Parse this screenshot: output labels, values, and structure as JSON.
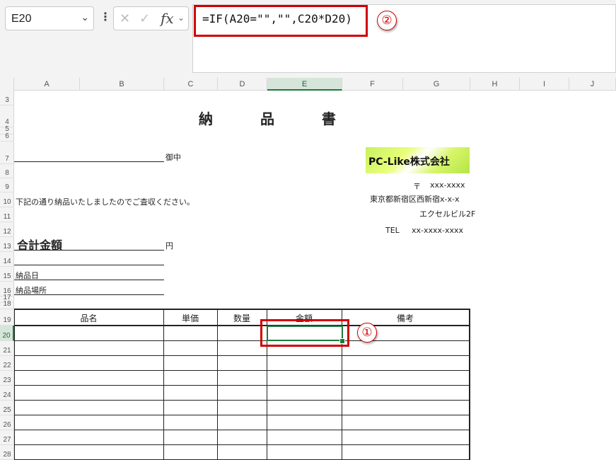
{
  "formula_bar": {
    "name_box": "E20",
    "fx_label": "fx",
    "formula": "=IF(A20=\"\",\"\",C20*D20)"
  },
  "annotations": {
    "circle1": "①",
    "circle2": "②"
  },
  "columns": [
    "A",
    "B",
    "C",
    "D",
    "E",
    "F",
    "G",
    "H",
    "I",
    "J"
  ],
  "rows": [
    "3",
    "4",
    "5",
    "6",
    "7",
    "8",
    "9",
    "10",
    "11",
    "12",
    "13",
    "14",
    "15",
    "16",
    "17",
    "18",
    "19",
    "20",
    "21",
    "22",
    "23",
    "24",
    "25",
    "26",
    "27",
    "28"
  ],
  "sheet": {
    "title": "納 品 書",
    "onchu": "御中",
    "company_logo": "PC-Like株式会社",
    "postal_mark": "〒",
    "postal_code": "xxx-xxxx",
    "address1": "東京都新宿区西新宿x-x-x",
    "address2": "エクセルビル2F",
    "tel_label": "TEL",
    "tel": "xx-xxxx-xxxx",
    "message": "下記の通り納品いたしましたのでご査収ください。",
    "total_label": "合計金額",
    "yen": "円",
    "delivery_date_label": "納品日",
    "delivery_place_label": "納品場所",
    "table_headers": [
      "品名",
      "単価",
      "数量",
      "金額",
      "備考"
    ]
  }
}
